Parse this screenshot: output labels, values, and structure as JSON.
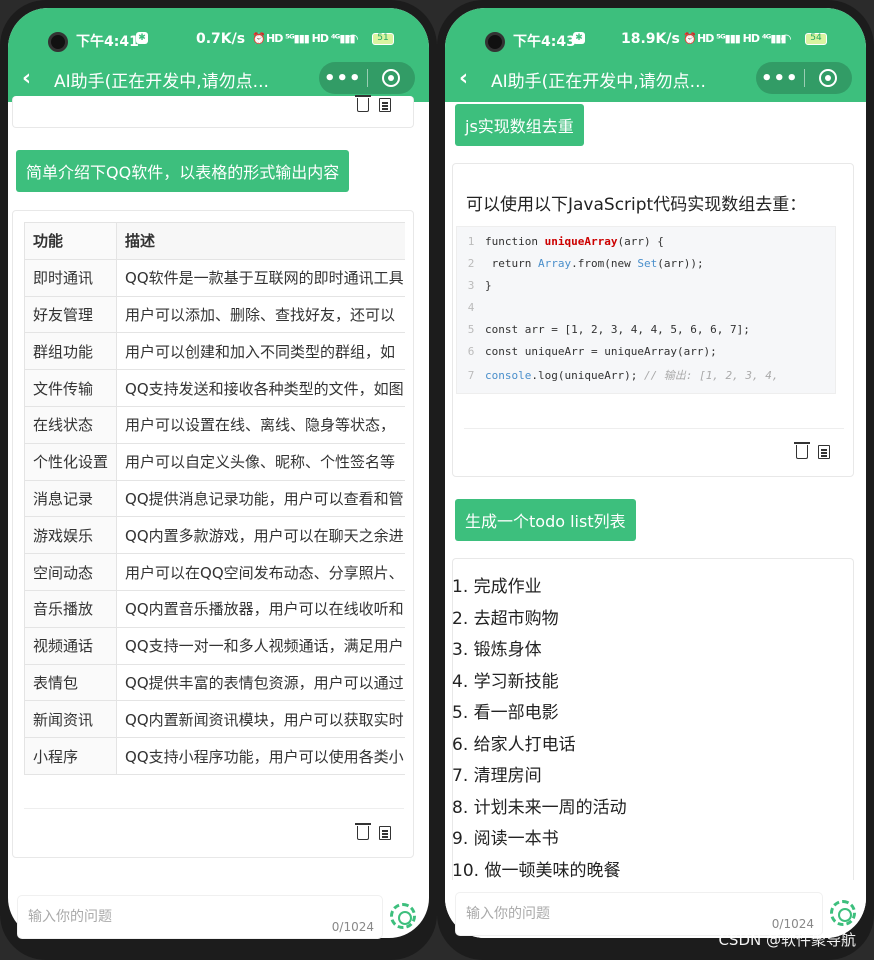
{
  "left": {
    "status": {
      "time": "下午4:41",
      "speed": "0.7K/s",
      "battery": "51"
    },
    "nav_title": "AI助手(正在开发中,请勿点...",
    "question": "简单介绍下QQ软件，以表格的形式输出内容",
    "table": {
      "headers": [
        "功能",
        "描述"
      ],
      "rows": [
        [
          "即时通讯",
          "QQ软件是一款基于互联网的即时通讯工具"
        ],
        [
          "好友管理",
          "用户可以添加、删除、查找好友，还可以"
        ],
        [
          "群组功能",
          "用户可以创建和加入不同类型的群组，如"
        ],
        [
          "文件传输",
          "QQ支持发送和接收各种类型的文件，如图"
        ],
        [
          "在线状态",
          "用户可以设置在线、离线、隐身等状态，"
        ],
        [
          "个性化设置",
          "用户可以自定义头像、昵称、个性签名等"
        ],
        [
          "消息记录",
          "QQ提供消息记录功能，用户可以查看和管"
        ],
        [
          "游戏娱乐",
          "QQ内置多款游戏，用户可以在聊天之余进"
        ],
        [
          "空间动态",
          "用户可以在QQ空间发布动态、分享照片、"
        ],
        [
          "音乐播放",
          "QQ内置音乐播放器，用户可以在线收听和"
        ],
        [
          "视频通话",
          "QQ支持一对一和多人视频通话，满足用户"
        ],
        [
          "表情包",
          "QQ提供丰富的表情包资源，用户可以通过"
        ],
        [
          "新闻资讯",
          "QQ内置新闻资讯模块，用户可以获取实时"
        ],
        [
          "小程序",
          "QQ支持小程序功能，用户可以使用各类小"
        ]
      ]
    },
    "input_placeholder": "输入你的问题",
    "counter": "0/1024"
  },
  "right": {
    "status": {
      "time": "下午4:43",
      "speed": "18.9K/s",
      "battery": "54"
    },
    "nav_title": "AI助手(正在开发中,请勿点...",
    "question1": "js实现数组去重",
    "answer_intro": "可以使用以下JavaScript代码实现数组去重：",
    "code_lines": [
      {
        "n": "1",
        "t": "function uniqueArray(arr) {"
      },
      {
        "n": "2",
        "t": "  return Array.from(new Set(arr));"
      },
      {
        "n": "3",
        "t": "}"
      },
      {
        "n": "4",
        "t": ""
      },
      {
        "n": "5",
        "t": "const arr = [1, 2, 3, 4, 4, 5, 6, 6, 7];"
      },
      {
        "n": "6",
        "t": "const uniqueArr = uniqueArray(arr);"
      },
      {
        "n": "7",
        "t": "console.log(uniqueArr); // 输出: [1, 2, 3, 4,"
      }
    ],
    "question2": "生成一个todo list列表",
    "todo": [
      "1. 完成作业",
      "2. 去超市购物",
      "3. 锻炼身体",
      "4. 学习新技能",
      "5. 看一部电影",
      "6. 给家人打电话",
      "7. 清理房间",
      "8. 计划未来一周的活动",
      "9. 阅读一本书",
      "10. 做一顿美味的晚餐"
    ],
    "input_placeholder": "输入你的问题",
    "counter": "0/1024"
  },
  "watermark": "CSDN @软件聚导航",
  "colors": {
    "accent": "#3dbf7d"
  }
}
